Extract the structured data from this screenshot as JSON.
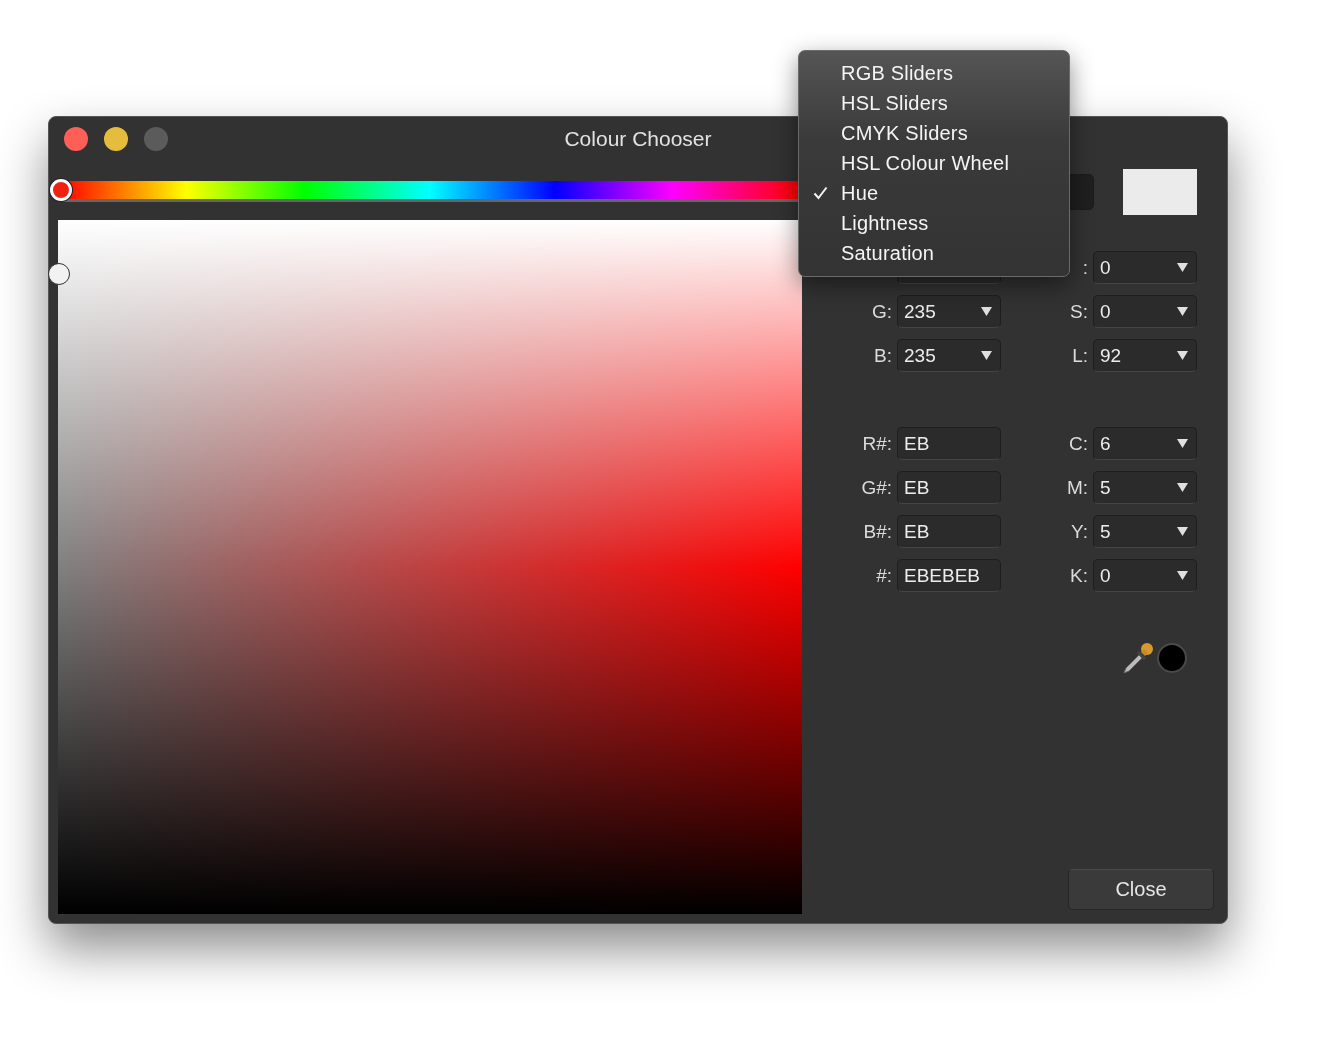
{
  "window": {
    "title": "Colour Chooser"
  },
  "hue_slider": {
    "level": 0
  },
  "mode_dropdown": {
    "expanded": true
  },
  "preview": {
    "color": "#ebebeb"
  },
  "left_fields": [
    {
      "kind": "dropdown"
    },
    {
      "label": "G:",
      "value": "235",
      "kind": "dropdown"
    },
    {
      "label": "B:",
      "value": "235",
      "kind": "dropdown"
    },
    {
      "label": "R#:",
      "value": "EB",
      "kind": "text"
    },
    {
      "label": "G#:",
      "value": "EB",
      "kind": "text"
    },
    {
      "label": "B#:",
      "value": "EB",
      "kind": "text"
    },
    {
      "label": "#:",
      "value": "EBEBEB",
      "kind": "text"
    }
  ],
  "right_fields": [
    {
      "label": ":",
      "value": "0",
      "kind": "dropdown"
    },
    {
      "label": "S:",
      "value": "0",
      "kind": "dropdown"
    },
    {
      "label": "L:",
      "value": "92",
      "kind": "dropdown"
    },
    {
      "label": "C:",
      "value": "6",
      "kind": "dropdown"
    },
    {
      "label": "M:",
      "value": "5",
      "kind": "dropdown"
    },
    {
      "label": "Y:",
      "value": "5",
      "kind": "dropdown"
    },
    {
      "label": "K:",
      "value": "0",
      "kind": "dropdown"
    }
  ],
  "picked_color": {
    "color": "#000000"
  },
  "buttons": [
    {
      "label": "Close"
    }
  ],
  "mode_menu": {
    "items": [
      {
        "label": "RGB Sliders",
        "checked": false
      },
      {
        "label": "HSL Sliders",
        "checked": false
      },
      {
        "label": "CMYK Sliders",
        "checked": false
      },
      {
        "label": "HSL Colour Wheel",
        "checked": false
      },
      {
        "label": "Hue",
        "checked": true
      },
      {
        "label": "Lightness",
        "checked": false
      },
      {
        "label": "Saturation",
        "checked": false
      }
    ]
  }
}
